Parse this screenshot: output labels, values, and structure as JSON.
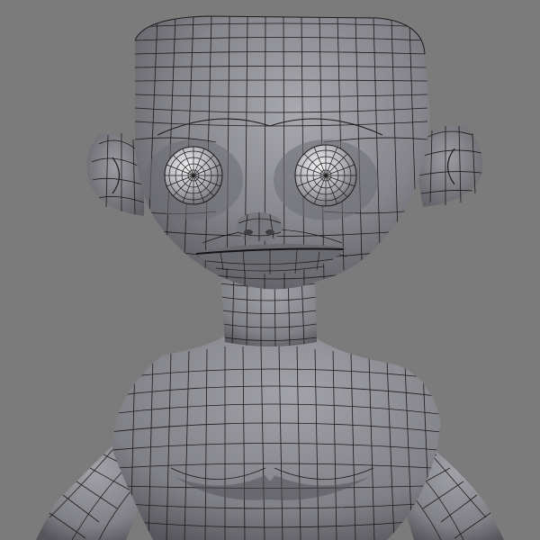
{
  "viewport": {
    "background": "#7b7b7b",
    "model_fill": "#8a8a90",
    "model_shadow": "#5c5c62",
    "model_highlight": "#b8b8c0",
    "wire_color": "#1a1a1a"
  }
}
